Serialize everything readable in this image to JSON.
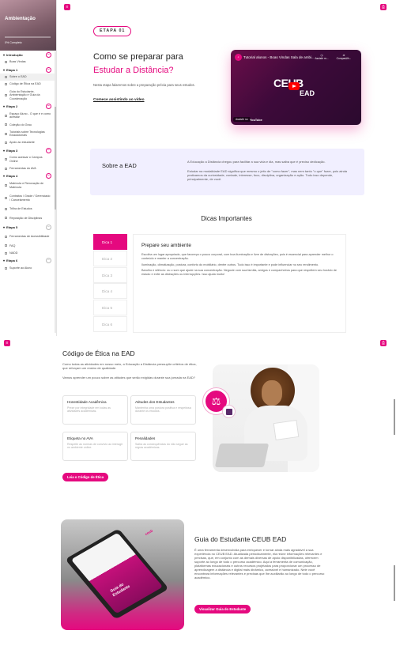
{
  "sidebar": {
    "course_title": "Ambientação",
    "progress_text": "0% Completo",
    "sections": [
      {
        "label": "Introdução",
        "items": [
          "Boas Vindas"
        ]
      },
      {
        "label": "Etapa 1",
        "items": [
          "Sobre o EAD",
          "Código de Ética na EAD",
          "Guia do Estudante, Ambientação e Guia da Coordenação"
        ]
      },
      {
        "label": "Etapa 2",
        "items": [
          "Espaço Aluno - O que é e como acessar",
          "Coleção do Grau",
          "Tutoriais sobre Tecnologias Educacionais",
          "Apoio ao estudante"
        ]
      },
      {
        "label": "Etapa 3",
        "items": [
          "Como acessar o Campus Online",
          "Ferramentas do AVA"
        ]
      },
      {
        "label": "Etapa 4",
        "items": [
          "Matrícula e Renovação de Matrícula",
          "Contratos / Grade / Gerenciado / Cancelamento",
          "Trilha de Estudos",
          "Reposição de Disciplinas"
        ]
      },
      {
        "label": "Etapa 5",
        "items": [
          "Ferramentas de Acessibilidade",
          "FAQ",
          "NADD"
        ]
      },
      {
        "label": "Etapa 6",
        "items": [
          "Suporte ao Aluno"
        ]
      }
    ]
  },
  "step": {
    "badge": "ETAPA 01"
  },
  "hero": {
    "title_line1": "Como se preparar para",
    "title_line2": "Estudar a Distância?",
    "intro": "Nesta etapa falaremos sobre a preparação prévia para seus estudos.",
    "cta": "Comece assistindo ao vídeo"
  },
  "video": {
    "title": "Tutorial alunos - Boas Vindas Sala de ambi...",
    "watch_later": "Assistir m...",
    "share": "Comparțilh...",
    "brand": "CEUB",
    "brand_sub": "EAD",
    "watch_on": "Assistir no",
    "youtube": "YouTube"
  },
  "about": {
    "heading": "Sobre a EAD",
    "p1": "A Educação a Distância chegou para facilitar a sua vida e dia, mas saiba que é preciso dedicação.",
    "p2": "Estudar na modalidade EAD significa que mesmo o jeito de \"como fazer\", mas nem tanto \"o que\" fazer, pois ainda praticamos da curiosidade, vontade, interesse, foco, disciplina, organização e ação. Tudo isso depende, principalmente, de você."
  },
  "tips": {
    "heading": "Dicas Importantes",
    "tabs": [
      "Dica 1",
      "Dica 2",
      "Dica 3",
      "Dica 4",
      "Dica 5",
      "Dica 6"
    ],
    "active_title": "Prepare seu ambiente",
    "active_p1": "Escolha um lugar apropriado, que favoreça o pouco corporal, com boa iluminação e livre de distrações, pois é essencial para aprender melhor o conteúdo e manter a concentração.",
    "active_p2": "Iluminação, climatização, postura, conforto do mobiliário, dentre outros. Tudo isso é importante e pode influenciar no seu rendimento.",
    "active_p3": "Barulho e silêncio: ou o som que ajude na sua concentração. Negocie com sua família, amigos e companheiros para que respeitem seu horário de estudo e evite as distrações ou interrupções. Isso ajuda muito!"
  },
  "ethics": {
    "heading": "Código de Ética na EAD",
    "p1": "Como todas as atividades em nosso meio, a Educação a Distância pressupõe critérios de ética, que reforçam um ensino de qualidade.",
    "p2": "Vamos aprender um pouco sobre as atitudes que serão exigidas durante sua jornada na EAD?",
    "cards": [
      {
        "title": "Honestidade Acadêmica",
        "text": "Preze por integridade em todas as atividades acadêmicas."
      },
      {
        "title": "Atitudes dos Estudantes",
        "text": "Mantenha uma postura positiva e respeitosa durante os estudos."
      },
      {
        "title": "Etiqueta no AVA",
        "text": "Respeite as normas de convívio ao interagir no ambiente online."
      },
      {
        "title": "Penalidades",
        "text": "Saiba as consequências do não seguir as regras acadêmicas."
      }
    ],
    "cta": "Leia o Código de Ética"
  },
  "guide": {
    "heading": "Guia do Estudante CEUB EAD",
    "text": "É uma ferramenta desenvolvida para enriquecer e tornar ainda mais agradável a sua experiência no CEUB EAD. Atualizada periodicamente, ela reúne informações relevantes e precisas, que, em conjunto com as demais diversas de apoio disponibilizadas, oferecem suporte ao longo de todo o percurso acadêmico. Aqui a ferramenta de comunicação, plataformas educacionais e outros recursos projetados para proporcionar um processo de aprendizagem a distância e digital mais dinâmico, acessível e humanizado. Nele você encontrará informações relevantes e precisas que lhe auxiliarão ao longo de todo o percurso acadêmico.",
    "cta": "Visualizar Guia do Estudante",
    "cover_text": "Guia do Estudante",
    "cover_logo": "ceub"
  },
  "colors": {
    "accent": "#e5097f",
    "soft_bg": "#f1efff"
  }
}
